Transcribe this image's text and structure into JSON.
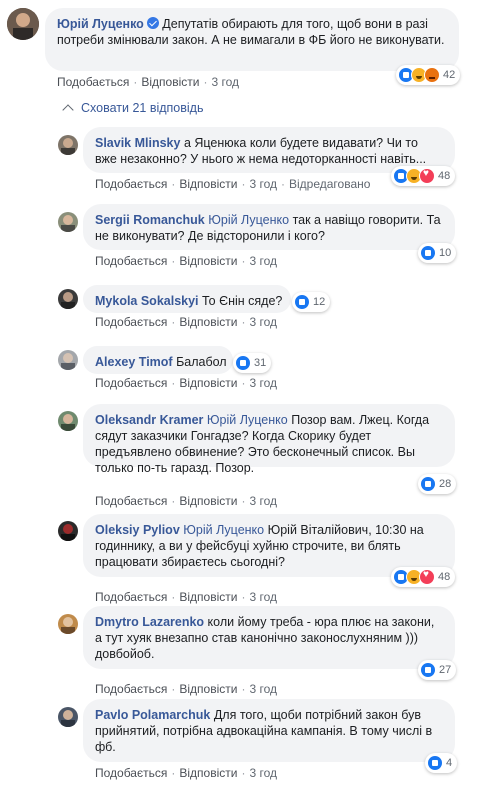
{
  "main_comment": {
    "author": "Юрій Луценко",
    "verified": true,
    "text": "Депутатів обирають для того, щоб вони в разі потреби змінювали закон. А не вимагали в ФБ його не виконувати.",
    "like_label": "Подобається",
    "reply_label": "Відповісти",
    "time": "3 год",
    "reactions": [
      "like",
      "haha",
      "angry"
    ],
    "reaction_count": "42"
  },
  "hide_replies_label": "Сховати 21 відповідь",
  "replies": [
    {
      "author": "Slavik Mlinsky",
      "mention": "",
      "text": "а Яценюка коли будете видавати? Чи то вже незаконно? У нього ж нема недоторканності навіть...",
      "like_label": "Подобається",
      "reply_label": "Відповісти",
      "time": "3 год",
      "edited": "Відредаговано",
      "reactions": [
        "like",
        "haha",
        "love"
      ],
      "reaction_count": "48"
    },
    {
      "author": "Sergii Romanchuk",
      "mention": "Юрій Луценко",
      "text": "так а навіщо говорити. Та не виконувати? Де відсторонили і кого?",
      "like_label": "Подобається",
      "reply_label": "Відповісти",
      "time": "3 год",
      "edited": "",
      "reactions": [
        "like"
      ],
      "reaction_count": "10"
    },
    {
      "author": "Mykola Sokalskyi",
      "mention": "",
      "text": "То Єнін сяде?",
      "like_label": "Подобається",
      "reply_label": "Відповісти",
      "time": "3 год",
      "edited": "",
      "reactions": [
        "like"
      ],
      "reaction_count": "12"
    },
    {
      "author": "Alexey Timof",
      "mention": "",
      "text": "Балабол",
      "like_label": "Подобається",
      "reply_label": "Відповісти",
      "time": "3 год",
      "edited": "",
      "reactions": [
        "like"
      ],
      "reaction_count": "31"
    },
    {
      "author": "Oleksandr Kramer",
      "mention": "Юрій Луценко",
      "text": "Позор вам. Лжец. Когда сядут заказчики Гонгадзе? Когда Скорику будет предъявлено обвинение? Это бесконечный список. Вы только по-ть гаразд. Позор.",
      "like_label": "Подобається",
      "reply_label": "Відповісти",
      "time": "3 год",
      "edited": "",
      "reactions": [
        "like"
      ],
      "reaction_count": "28"
    },
    {
      "author": "Oleksiy Pyliov",
      "mention": "Юрій Луценко",
      "text": "Юрій Віталійович, 10:30 на годиннику, а ви у фейсбуці хуйню строчите, ви блять працювати збираєтесь сьогодні?",
      "like_label": "Подобається",
      "reply_label": "Відповісти",
      "time": "3 год",
      "edited": "",
      "reactions": [
        "like",
        "haha",
        "love"
      ],
      "reaction_count": "48"
    },
    {
      "author": "Dmytro Lazarenko",
      "mention": "",
      "text": "коли йому треба - юра плює на закони, а тут хуяк внезапно став канонічно законослухняним ))) довбойоб.",
      "like_label": "Подобається",
      "reply_label": "Відповісти",
      "time": "3 год",
      "edited": "",
      "reactions": [
        "like"
      ],
      "reaction_count": "27"
    },
    {
      "author": "Pavlo Polamarchuk",
      "mention": "",
      "text": "Для того, щоби потрібний закон був прийнятий, потрібна адвокаційна кампанія. В тому числі в фб.",
      "like_label": "Подобається",
      "reply_label": "Відповісти",
      "time": "3 год",
      "edited": "",
      "reactions": [
        "like"
      ],
      "reaction_count": "4"
    }
  ]
}
